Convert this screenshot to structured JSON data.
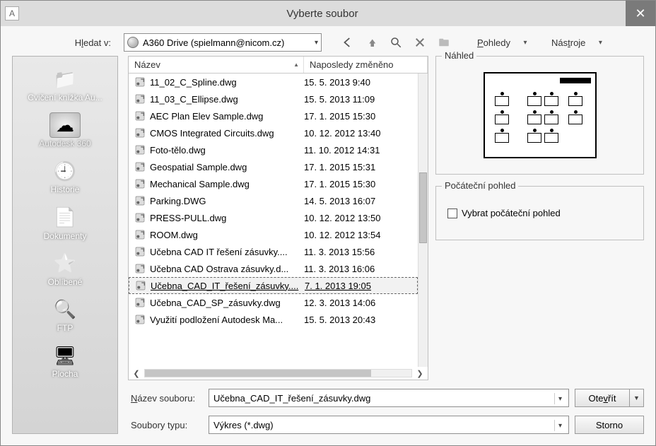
{
  "title": "Vyberte soubor",
  "lookin_label_pre": "H",
  "lookin_label_u": "l",
  "lookin_label_post": "edat v:",
  "lookin_value": "A360 Drive (spielmann@nicom.cz)",
  "menu_views_pre": "",
  "menu_views_u": "P",
  "menu_views_post": "ohledy",
  "menu_tools_pre": "Nás",
  "menu_tools_u": "t",
  "menu_tools_post": "roje",
  "col_name": "Název",
  "col_date": "Naposledy změněno",
  "files": [
    {
      "name": "11_02_C_Spline.dwg",
      "date": "15. 5. 2013 9:40"
    },
    {
      "name": "11_03_C_Ellipse.dwg",
      "date": "15. 5. 2013 11:09"
    },
    {
      "name": "AEC Plan Elev Sample.dwg",
      "date": "17. 1. 2015 15:30"
    },
    {
      "name": "CMOS Integrated Circuits.dwg",
      "date": "10. 12. 2012 13:40"
    },
    {
      "name": "Foto-tělo.dwg",
      "date": "11. 10. 2012 14:31"
    },
    {
      "name": "Geospatial Sample.dwg",
      "date": "17. 1. 2015 15:31"
    },
    {
      "name": "Mechanical Sample.dwg",
      "date": "17. 1. 2015 15:30"
    },
    {
      "name": "Parking.DWG",
      "date": "14. 5. 2013 16:07"
    },
    {
      "name": "PRESS-PULL.dwg",
      "date": "10. 12. 2012 13:50"
    },
    {
      "name": "ROOM.dwg",
      "date": "10. 12. 2012 13:54"
    },
    {
      "name": "Učebna CAD IT řešení zásuvky....",
      "date": "11. 3. 2013 15:56"
    },
    {
      "name": "Učebna CAD Ostrava zásuvky.d...",
      "date": "11. 3. 2013 16:06"
    },
    {
      "name": "Učebna_CAD_IT_řešení_zásuvky....",
      "date": "7. 1. 2013 19:05"
    },
    {
      "name": "Učebna_CAD_SP_zásuvky.dwg",
      "date": "12. 3. 2013 14:06"
    },
    {
      "name": "Využití podložení Autodesk Ma...",
      "date": "15. 5. 2013 20:43"
    }
  ],
  "selected_file_index": 12,
  "places": [
    {
      "label": "Cvičení knížka Au..."
    },
    {
      "label": "Autodesk 360"
    },
    {
      "label": "Historie"
    },
    {
      "label": "Dokumenty"
    },
    {
      "label": "Oblíbené"
    },
    {
      "label": "FTP"
    },
    {
      "label": "Plocha"
    }
  ],
  "selected_place_index": 1,
  "preview_label": "Náhled",
  "initview_label": "Počáteční pohled",
  "initview_check": "Vybrat počáteční pohled",
  "filename_label_pre": "",
  "filename_label_u": "N",
  "filename_label_post": "ázev souboru:",
  "filetype_label": "Soubory typu:",
  "filename_value": "Učebna_CAD_IT_řešení_zásuvky.dwg",
  "filetype_value": "Výkres (*.dwg)",
  "btn_open_pre": "Ote",
  "btn_open_u": "v",
  "btn_open_post": "řít",
  "btn_cancel": "Storno"
}
